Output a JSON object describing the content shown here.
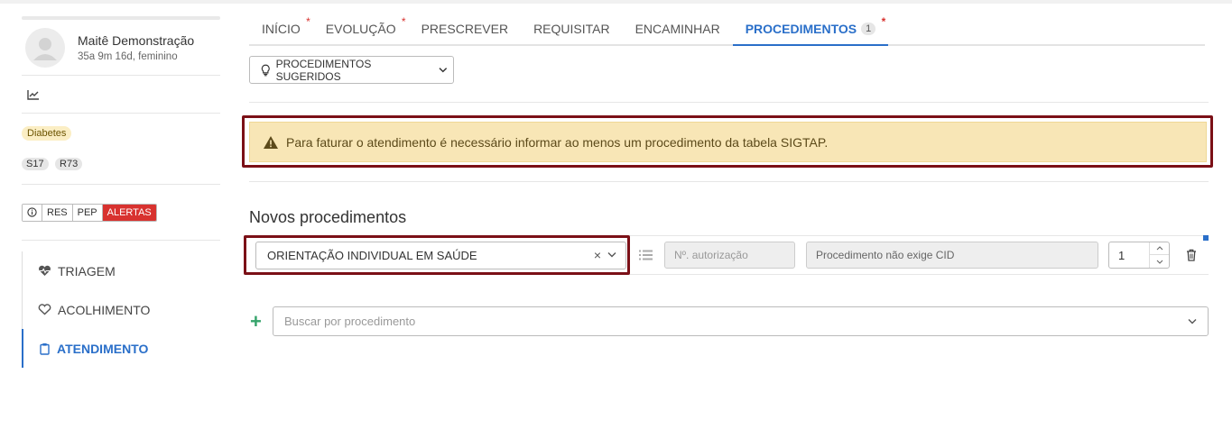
{
  "patient": {
    "name": "Maitê Demonstração",
    "meta": "35a 9m 16d, feminino"
  },
  "tags": {
    "condition": "Diabetes",
    "cids": [
      "S17",
      "R73"
    ]
  },
  "record_buttons": {
    "res": "RES",
    "pep": "PEP",
    "alerts": "ALERTAS"
  },
  "nav": {
    "triagem": "TRIAGEM",
    "acolhimento": "ACOLHIMENTO",
    "atendimento": "ATENDIMENTO"
  },
  "tabs": {
    "inicio": "INÍCIO",
    "evolucao": "EVOLUÇÃO",
    "prescrever": "PRESCREVER",
    "requisitar": "REQUISITAR",
    "encaminhar": "ENCAMINHAR",
    "procedimentos": "PROCEDIMENTOS",
    "procedimentos_count": "1",
    "asterisk": "*"
  },
  "suggested_button": "PROCEDIMENTOS SUGERIDOS",
  "warning": "Para faturar o atendimento é necessário informar ao menos um procedimento da tabela SIGTAP.",
  "section_title": "Novos procedimentos",
  "procedure_row": {
    "procedure": "ORIENTAÇÃO INDIVIDUAL EM SAÚDE",
    "clear_symbol": "×",
    "authorization_placeholder": "Nº. autorização",
    "cid_text": "Procedimento não exige CID",
    "quantity": "1"
  },
  "add_symbol": "+",
  "search": {
    "placeholder": "Buscar por procedimento"
  },
  "colors": {
    "accent": "#2a6fc9",
    "alert": "#d8322f",
    "warning_bg": "#f8e6b6",
    "highlight_border": "#7b1017",
    "add": "#35a36b"
  }
}
